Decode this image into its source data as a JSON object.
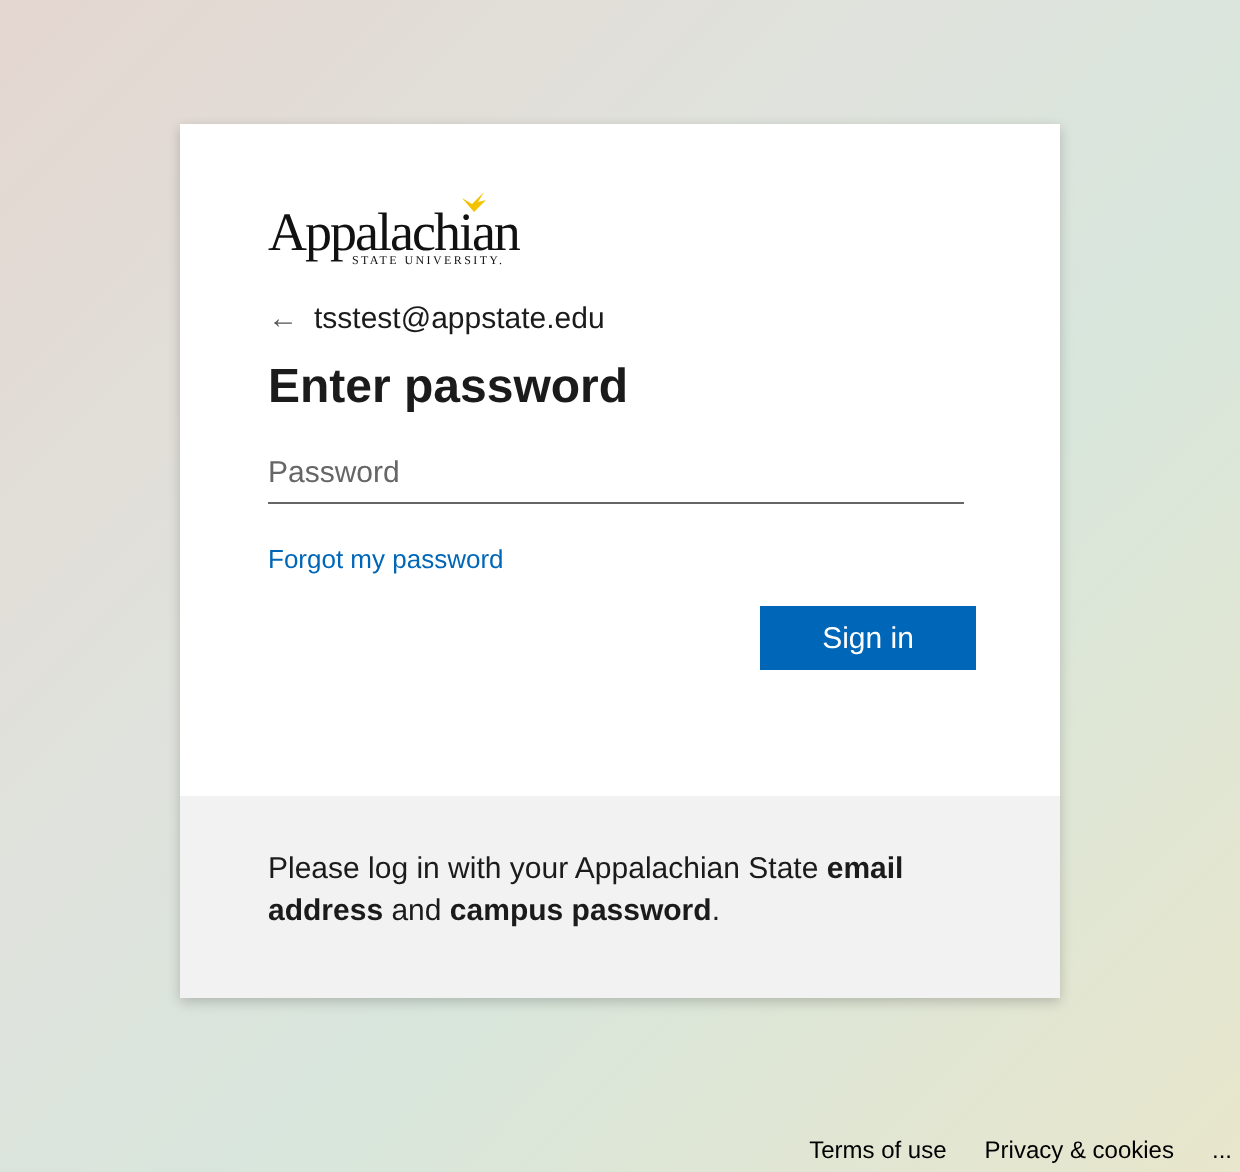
{
  "logo": {
    "name": "Appalachian",
    "subtitle": "STATE UNIVERSITY."
  },
  "account": {
    "back": "←",
    "email": "tsstest@appstate.edu"
  },
  "title": "Enter password",
  "password_field": {
    "placeholder": "Password"
  },
  "forgot_link": "Forgot my password",
  "sign_in_button": "Sign in",
  "note": "Please log in with your Appalachian State **email address** and **campus password**.",
  "footer_links": [
    "Terms of use",
    "Privacy & cookies",
    "..."
  ]
}
